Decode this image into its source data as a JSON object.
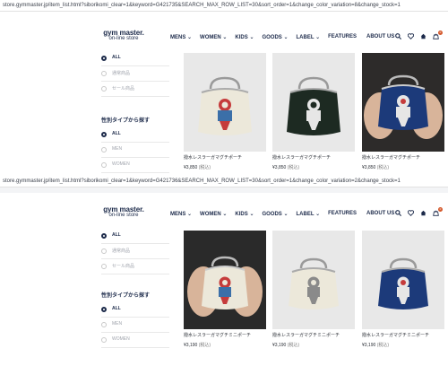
{
  "url_bar_1": "store.gymmaster.jp/item_list.html?siborikomi_clear=1&keyword=G421735&SEARCH_MAX_ROW_LIST=30&sort_order=1&change_color_variation=8&change_stock=1",
  "url_bar_2": "store.gymmaster.jp/item_list.html?siborikomi_clear=1&keyword=G421736&SEARCH_MAX_ROW_LIST=30&sort_order=1&change_color_variation=2&change_stock=1",
  "header": {
    "logo_main": "gym master.",
    "logo_sub": "on-line store",
    "nav": [
      "MENS",
      "WOMEN",
      "KIDS",
      "GOODS",
      "LABEL",
      "FEATURES",
      "ABOUT US"
    ],
    "nav_has_chevron": [
      true,
      true,
      true,
      true,
      true,
      false,
      false
    ],
    "chevron": "⌄",
    "icons": [
      "search-icon",
      "heart-icon",
      "home-icon",
      "cart-icon"
    ],
    "cart_count": "0"
  },
  "sidebar": {
    "stock_filters": [
      "ALL",
      "通常商品",
      "セール商品"
    ],
    "gender_heading": "性別タイプから探す",
    "gender_filters": [
      "ALL",
      "MEN",
      "WOMEN"
    ]
  },
  "section1": {
    "products": [
      {
        "name": "撥水レスラーガマグチポーチ",
        "price": "¥3,850",
        "tax": "(税込)"
      },
      {
        "name": "撥水レスラーガマグチポーチ",
        "price": "¥3,850",
        "tax": "(税込)"
      },
      {
        "name": "撥水レスラーガマグチポーチ",
        "price": "¥3,850",
        "tax": "(税込)"
      }
    ]
  },
  "section2": {
    "products": [
      {
        "name": "撥水レスラーガマグチミニポーチ",
        "price": "¥3,190",
        "tax": "(税込)"
      },
      {
        "name": "撥水レスラーガマグチミニポーチ",
        "price": "¥3,190",
        "tax": "(税込)"
      },
      {
        "name": "撥水レスラーガマグチミニポーチ",
        "price": "¥3,190",
        "tax": "(税込)"
      }
    ]
  },
  "colors": {
    "navy": "#1c2a4a",
    "accent": "#d4572a"
  }
}
